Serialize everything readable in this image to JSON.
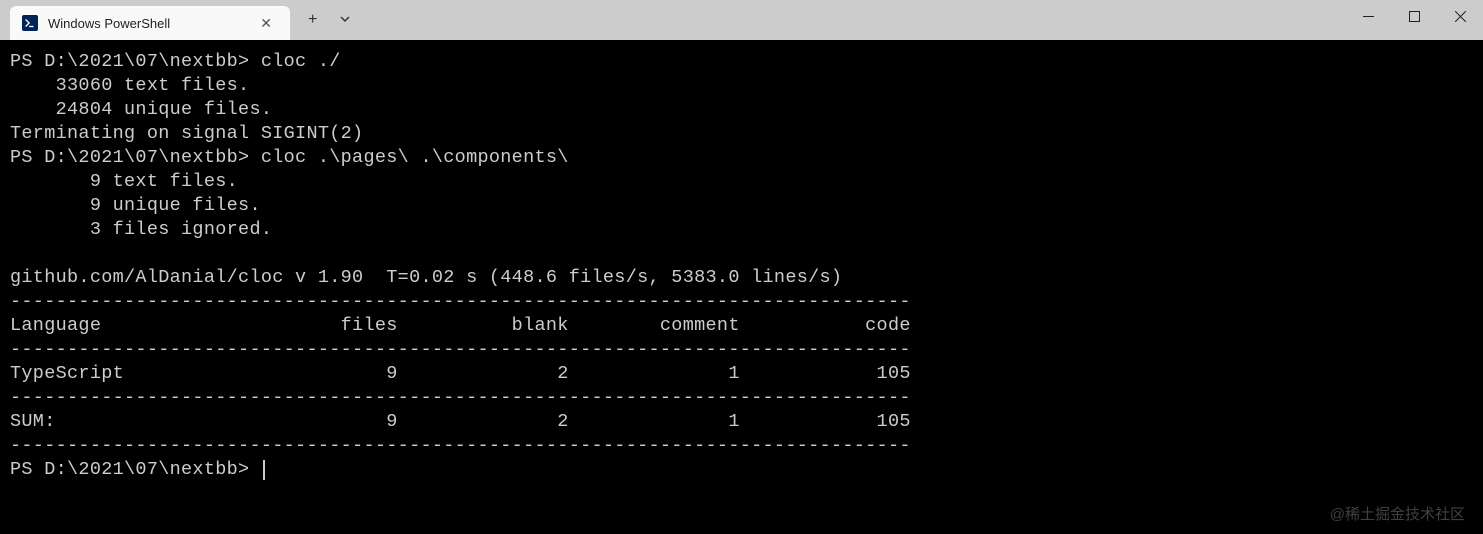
{
  "titlebar": {
    "tab_title": "Windows PowerShell"
  },
  "terminal": {
    "prompt1": "PS D:\\2021\\07\\nextbb> ",
    "cmd1": "cloc ./",
    "line_textfiles1": "    33060 text files.",
    "line_unique1": "    24804 unique files.",
    "line_terminate": "Terminating on signal SIGINT(2)",
    "prompt2": "PS D:\\2021\\07\\nextbb> ",
    "cmd2": "cloc .\\pages\\ .\\components\\",
    "line_textfiles2": "       9 text files.",
    "line_unique2": "       9 unique files.",
    "line_ignored": "       3 files ignored.",
    "line_version": "github.com/AlDanial/cloc v 1.90  T=0.02 s (448.6 files/s, 5383.0 lines/s)",
    "divider": "-------------------------------------------------------------------------------",
    "header_row": "Language                     files          blank        comment           code",
    "data_row": "TypeScript                       9              2              1            105",
    "sum_row": "SUM:                             9              2              1            105",
    "prompt3": "PS D:\\2021\\07\\nextbb> "
  },
  "watermark": "@稀土掘金技术社区",
  "chart_data": {
    "type": "table",
    "title": "cloc output",
    "columns": [
      "Language",
      "files",
      "blank",
      "comment",
      "code"
    ],
    "rows": [
      {
        "Language": "TypeScript",
        "files": 9,
        "blank": 2,
        "comment": 1,
        "code": 105
      }
    ],
    "sum": {
      "Language": "SUM:",
      "files": 9,
      "blank": 2,
      "comment": 1,
      "code": 105
    }
  }
}
